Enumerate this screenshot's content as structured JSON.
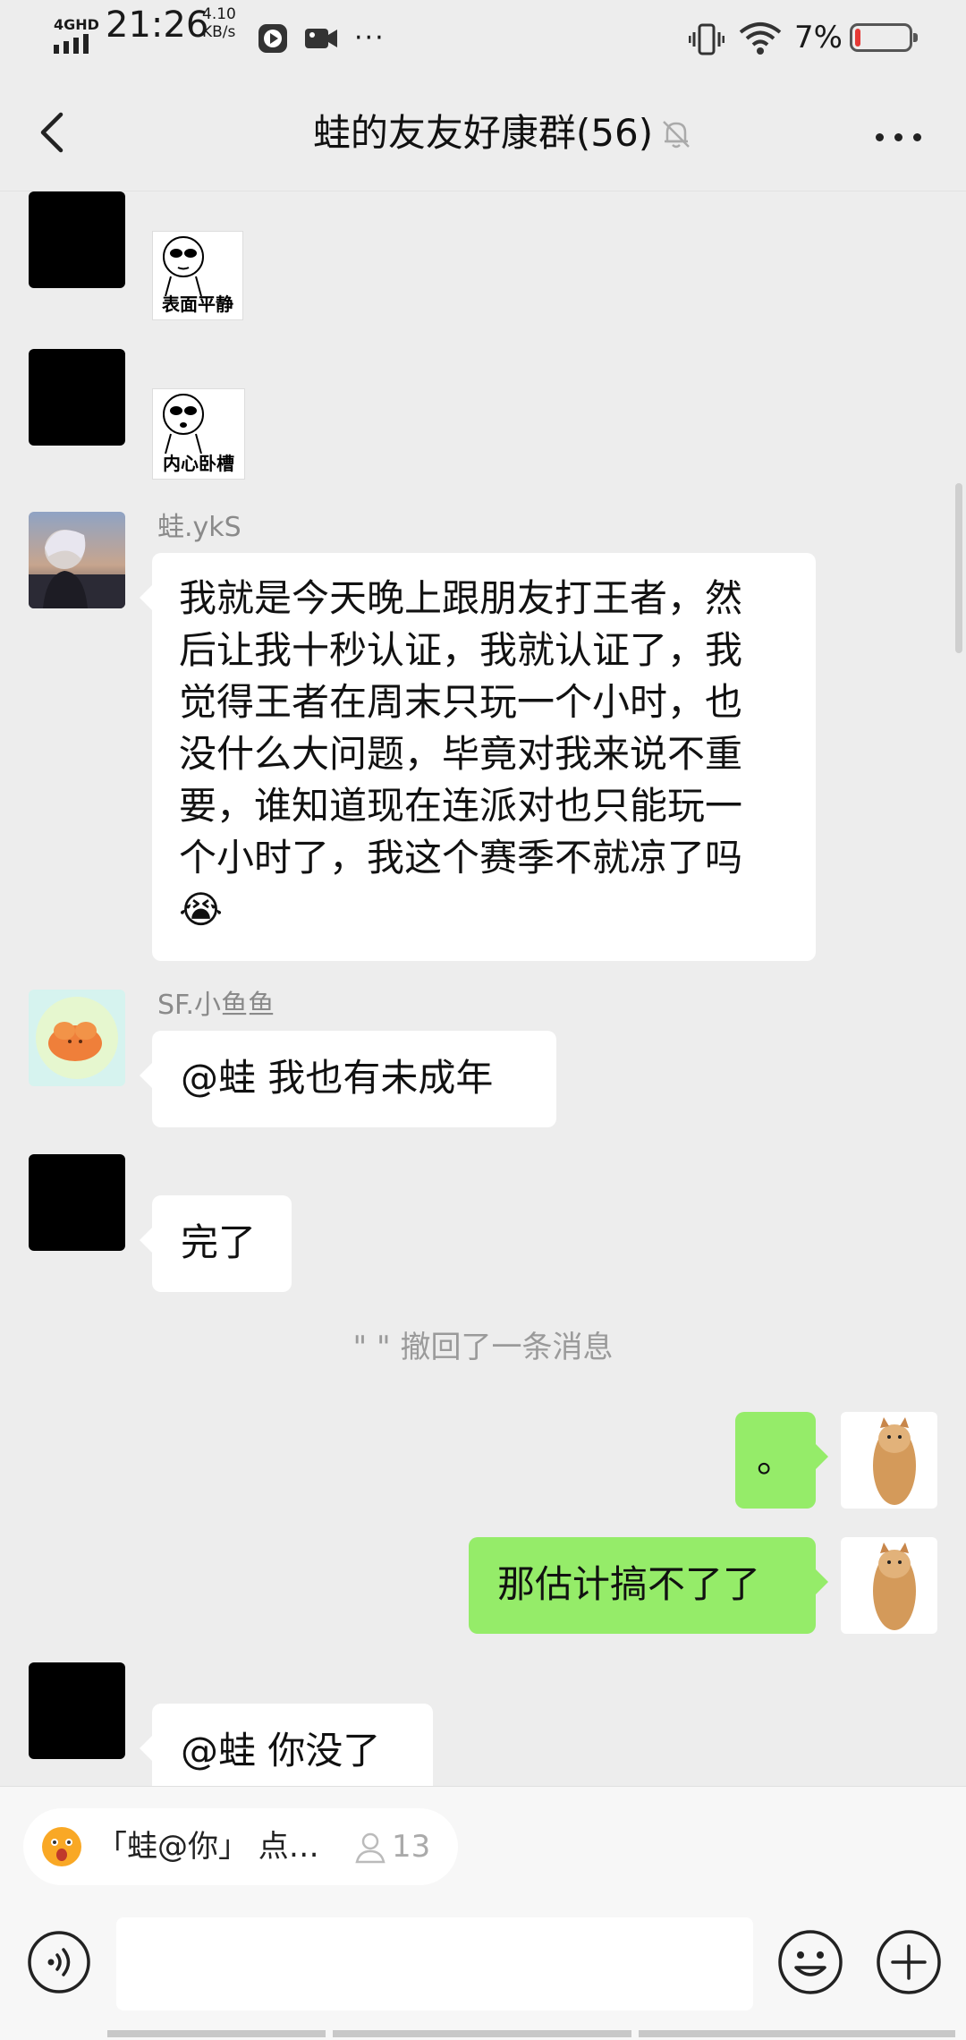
{
  "status_bar": {
    "network": "4GHD",
    "time": "21:26",
    "speed_value": "4.10",
    "speed_unit": "KB/s",
    "more": "···",
    "battery_percent": "7%"
  },
  "header": {
    "title": "蛙的友友好康群(56)"
  },
  "messages": {
    "sticker1_caption": "表面平静",
    "sticker2_caption": "内心卧槽",
    "m3_sender": "蛙.ykS",
    "m3_line1": "我就是今天晚上跟朋友打王者，然",
    "m3_line2": "后让我十秒认证，我就认证了，我",
    "m3_line3": "觉得王者在周末只玩一个小时，也",
    "m3_line4": "没什么大问题，毕竟对我来说不重",
    "m3_line5": "要，谁知道现在连派对也只能玩一",
    "m3_line6": "个小时了，我这个赛季不就凉了吗",
    "m3_emoji": "😭",
    "m4_sender": "SF.小鱼鱼",
    "m4_text": "@蛙  我也有未成年",
    "m5_text": "完了",
    "system_recall": "\"    \" 撤回了一条消息",
    "m6_text": "。",
    "m7_text": "那估计搞不了了",
    "m8_text": "@蛙  你没了"
  },
  "mention": {
    "text": "「蛙@你」 点…",
    "count": "13"
  },
  "colors": {
    "background": "#ededed",
    "bubble_self": "#95ec69",
    "bubble_other": "#ffffff",
    "battery_low": "#e53935"
  }
}
